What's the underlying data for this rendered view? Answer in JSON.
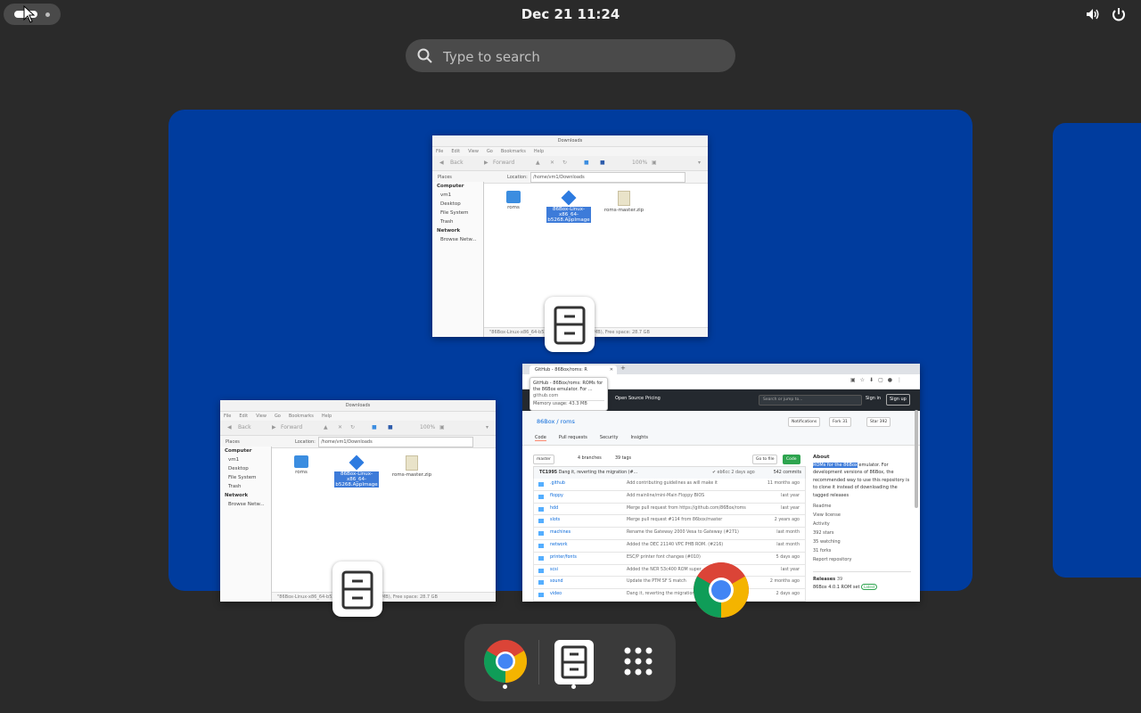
{
  "topbar": {
    "clock": "Dec 21  11:24",
    "tray": [
      "volume-icon",
      "power-icon"
    ]
  },
  "search": {
    "placeholder": "Type to search",
    "value": ""
  },
  "windows": {
    "file_manager_top": {
      "title": "Downloads",
      "menus": [
        "File",
        "Edit",
        "View",
        "Go",
        "Bookmarks",
        "Help"
      ],
      "toolbar": {
        "back": "Back",
        "forward": "Forward",
        "zoom": "100%"
      },
      "places_label": "Places",
      "location_label": "Location:",
      "path": "/home/vm1/Downloads",
      "sidebar": {
        "computer": "Computer",
        "items": [
          "vm1",
          "Desktop",
          "File System",
          "Trash"
        ],
        "network": "Network",
        "network_items": [
          "Browse Netw..."
        ]
      },
      "files": [
        {
          "name": "roms",
          "type": "folder"
        },
        {
          "name": "86Box-Linux-x86_64-b5268.AppImage",
          "type": "appimage",
          "selected": true
        },
        {
          "name": "roms-master.zip",
          "type": "zip"
        }
      ],
      "status": "\"86Box-Linux-x86_64-b5268...\" selected (55.0 MB), Free space: 28.7 GB"
    },
    "file_manager_bottom": {
      "title": "Downloads",
      "menus": [
        "File",
        "Edit",
        "View",
        "Go",
        "Bookmarks",
        "Help"
      ],
      "toolbar": {
        "back": "Back",
        "forward": "Forward",
        "zoom": "100%"
      },
      "places_label": "Places",
      "location_label": "Location:",
      "path": "/home/vm1/Downloads",
      "sidebar": {
        "computer": "Computer",
        "items": [
          "vm1",
          "Desktop",
          "File System",
          "Trash"
        ],
        "network": "Network",
        "network_items": [
          "Browse Netw..."
        ]
      },
      "files": [
        {
          "name": "roms",
          "type": "folder"
        },
        {
          "name": "86Box-Linux-x86_64-b5268.AppImage",
          "type": "appimage",
          "selected": true
        },
        {
          "name": "roms-master.zip",
          "type": "zip"
        }
      ],
      "status": "\"86Box-Linux-x86_64-b5268...\" selected (55.0 MB), Free space: 28.7 GB"
    },
    "chrome": {
      "tab_title": "GitHub - 86Box/roms: R",
      "tooltip": {
        "line1": "GitHub - 86Box/roms: ROMs for",
        "line2": "the 86Box emulator. For ...",
        "line3": "github.com",
        "memory": "Memory usage: 43.3 MB"
      },
      "header": {
        "nav": [
          "Open Source",
          "Pricing"
        ],
        "search_placeholder": "Search or jump to...",
        "sign_in": "Sign in",
        "sign_up": "Sign up"
      },
      "repo": {
        "name": "86Box / roms",
        "notifications": "Notifications",
        "fork": "Fork",
        "fork_count": "31",
        "star": "Star",
        "star_count": "392",
        "tabs": [
          "Code",
          "Pull requests",
          "Security",
          "Insights"
        ]
      },
      "branch_bar": {
        "branch": "master",
        "branches": "4 branches",
        "tags": "39 tags",
        "goto": "Go to file",
        "code": "Code"
      },
      "commit": {
        "author": "TC1995",
        "message": "Dang it, reverting the migration (#...",
        "meta": "✔ eb6cc 2 days ago",
        "commits": "542 commits"
      },
      "files": [
        {
          "name": ".github",
          "msg": "Add contributing guidelines as will make it",
          "age": "11 months ago"
        },
        {
          "name": "floppy",
          "msg": "Add mainline/mini-Main Floppy BIOS",
          "age": "last year"
        },
        {
          "name": "hdd",
          "msg": "Merge pull request from https://github.com/86Box/roms",
          "age": "last year"
        },
        {
          "name": "slots",
          "msg": "Merge pull request #114 from 86box/master",
          "age": "2 years ago"
        },
        {
          "name": "machines",
          "msg": "Rename the Gateway 2000 Vesa to Gateway (#271)",
          "age": "last month"
        },
        {
          "name": "network",
          "msg": "Added the DEC 21140 VPC PHB ROM. (#216)",
          "age": "last month"
        },
        {
          "name": "printer/fonts",
          "msg": "ESC/P printer font changes (#010)",
          "age": "5 days ago"
        },
        {
          "name": "scsi",
          "msg": "Added the NCR 53c400 ROM super...",
          "age": "last year"
        },
        {
          "name": "sound",
          "msg": "Update the PTM SF S match",
          "age": "2 months ago"
        },
        {
          "name": "video",
          "msg": "Dang it, reverting the migration (#...)",
          "age": "2 days ago"
        }
      ],
      "about": {
        "heading": "About",
        "highlight": "ROMs for the 86Box",
        "desc": " emulator. For development versions of 86Box, the recommended way to use this repository is to clone it instead of downloading the tagged releases",
        "links": [
          "Readme",
          "View license",
          "Activity",
          "392 stars",
          "35 watching",
          "31 forks",
          "Report repository"
        ],
        "releases": "Releases",
        "releases_count": "39",
        "latest": "86Box 4.0.1 ROM set",
        "latest_badge": "Latest"
      }
    }
  },
  "dock": {
    "items": [
      "chrome-icon",
      "file-manager-icon",
      "app-grid-icon"
    ]
  },
  "colors": {
    "background": "#2a2a2a",
    "workspace": "#003c9e",
    "selection": "#3d7bd9",
    "github_green": "#2da44e"
  }
}
